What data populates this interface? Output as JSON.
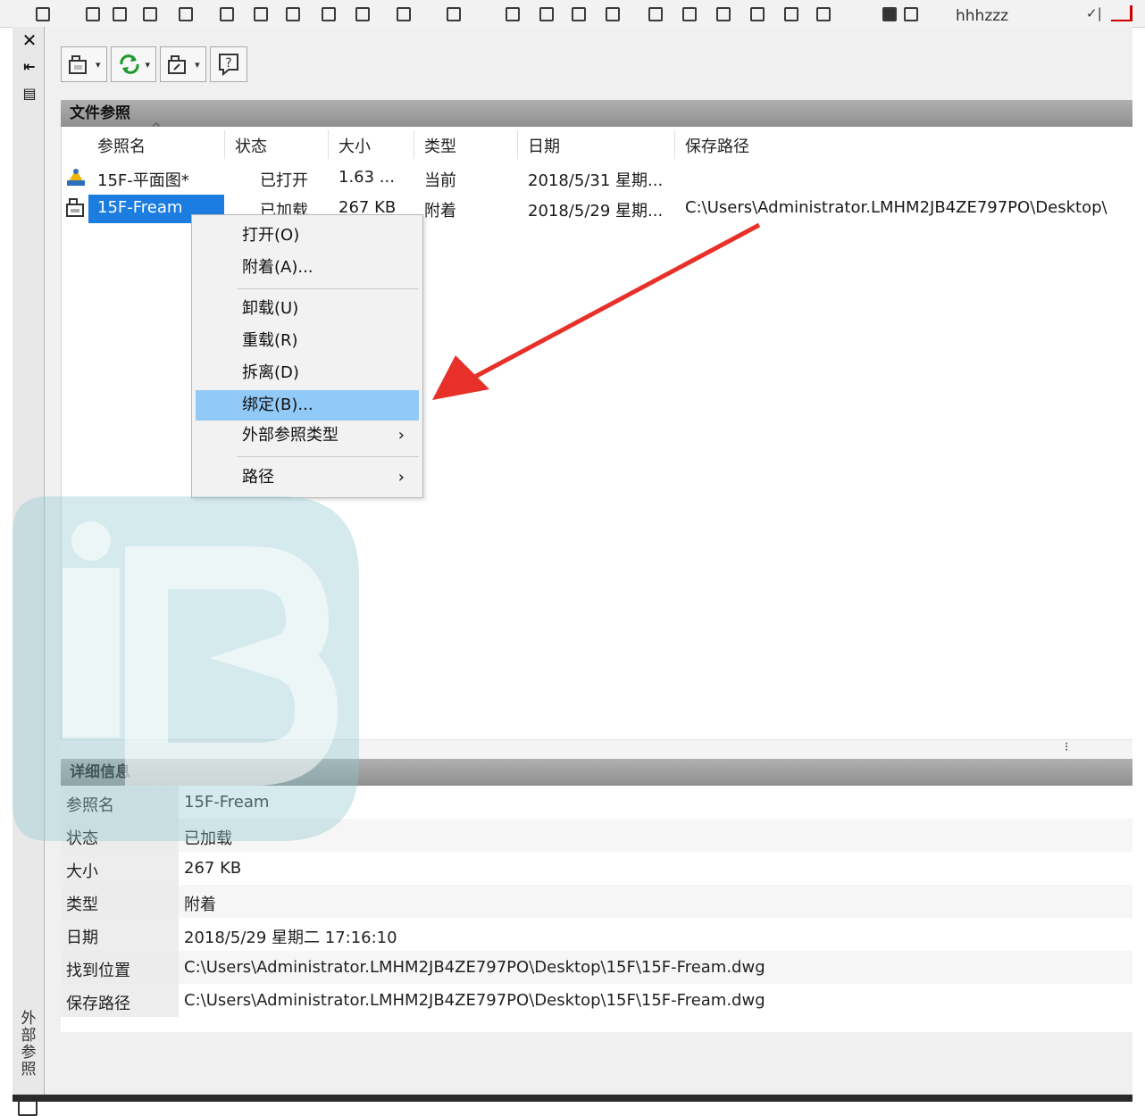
{
  "top_bar": {
    "user": "hhhzzz"
  },
  "side_panel": {
    "title": "外部参照"
  },
  "toolbar": {
    "buttons": [
      {
        "name": "attach-dwg",
        "has_dropdown": true
      },
      {
        "name": "refresh",
        "has_dropdown": true
      },
      {
        "name": "change-path",
        "has_dropdown": true
      },
      {
        "name": "help",
        "has_dropdown": false
      }
    ]
  },
  "file_refs": {
    "header": "文件参照",
    "columns": [
      "参照名",
      "状态",
      "大小",
      "类型",
      "日期",
      "保存路径"
    ],
    "rows": [
      {
        "name": "15F-平面图*",
        "status": "已打开",
        "size": "1.63 ...",
        "type": "当前",
        "date": "2018/5/31 星期...",
        "path": "",
        "selected": false
      },
      {
        "name": "15F-Fream",
        "status": "已加载",
        "size": "267 KB",
        "type": "附着",
        "date": "2018/5/29 星期...",
        "path": "C:\\Users\\Administrator.LMHM2JB4ZE797PO\\Desktop\\",
        "selected": true
      }
    ]
  },
  "context_menu": {
    "items": [
      {
        "label": "打开(O)",
        "submenu": false,
        "highlighted": false
      },
      {
        "label": "附着(A)...",
        "submenu": false,
        "highlighted": false
      },
      {
        "label": "卸载(U)",
        "submenu": false,
        "highlighted": false
      },
      {
        "label": "重载(R)",
        "submenu": false,
        "highlighted": false
      },
      {
        "label": "拆离(D)",
        "submenu": false,
        "highlighted": false
      },
      {
        "label": "绑定(B)...",
        "submenu": false,
        "highlighted": true
      },
      {
        "label": "外部参照类型",
        "submenu": true,
        "submenu_glyph": "›",
        "highlighted": false
      },
      {
        "label": "路径",
        "submenu": true,
        "submenu_glyph": "›",
        "highlighted": false
      }
    ]
  },
  "details": {
    "header": "详细信息",
    "rows": [
      {
        "label": "参照名",
        "value": "15F-Fream"
      },
      {
        "label": "状态",
        "value": "已加载"
      },
      {
        "label": "大小",
        "value": "267 KB"
      },
      {
        "label": "类型",
        "value": "附着"
      },
      {
        "label": "日期",
        "value": "2018/5/29 星期二 17:16:10"
      },
      {
        "label": "找到位置",
        "value": "C:\\Users\\Administrator.LMHM2JB4ZE797PO\\Desktop\\15F\\15F-Fream.dwg"
      },
      {
        "label": "保存路径",
        "value": "C:\\Users\\Administrator.LMHM2JB4ZE797PO\\Desktop\\15F\\15F-Fream.dwg"
      }
    ]
  },
  "colors": {
    "selection": "#1b7de0",
    "menu_highlight": "#91c9f7",
    "annotation_arrow": "#e8302a",
    "watermark": "#8fc8cc"
  }
}
